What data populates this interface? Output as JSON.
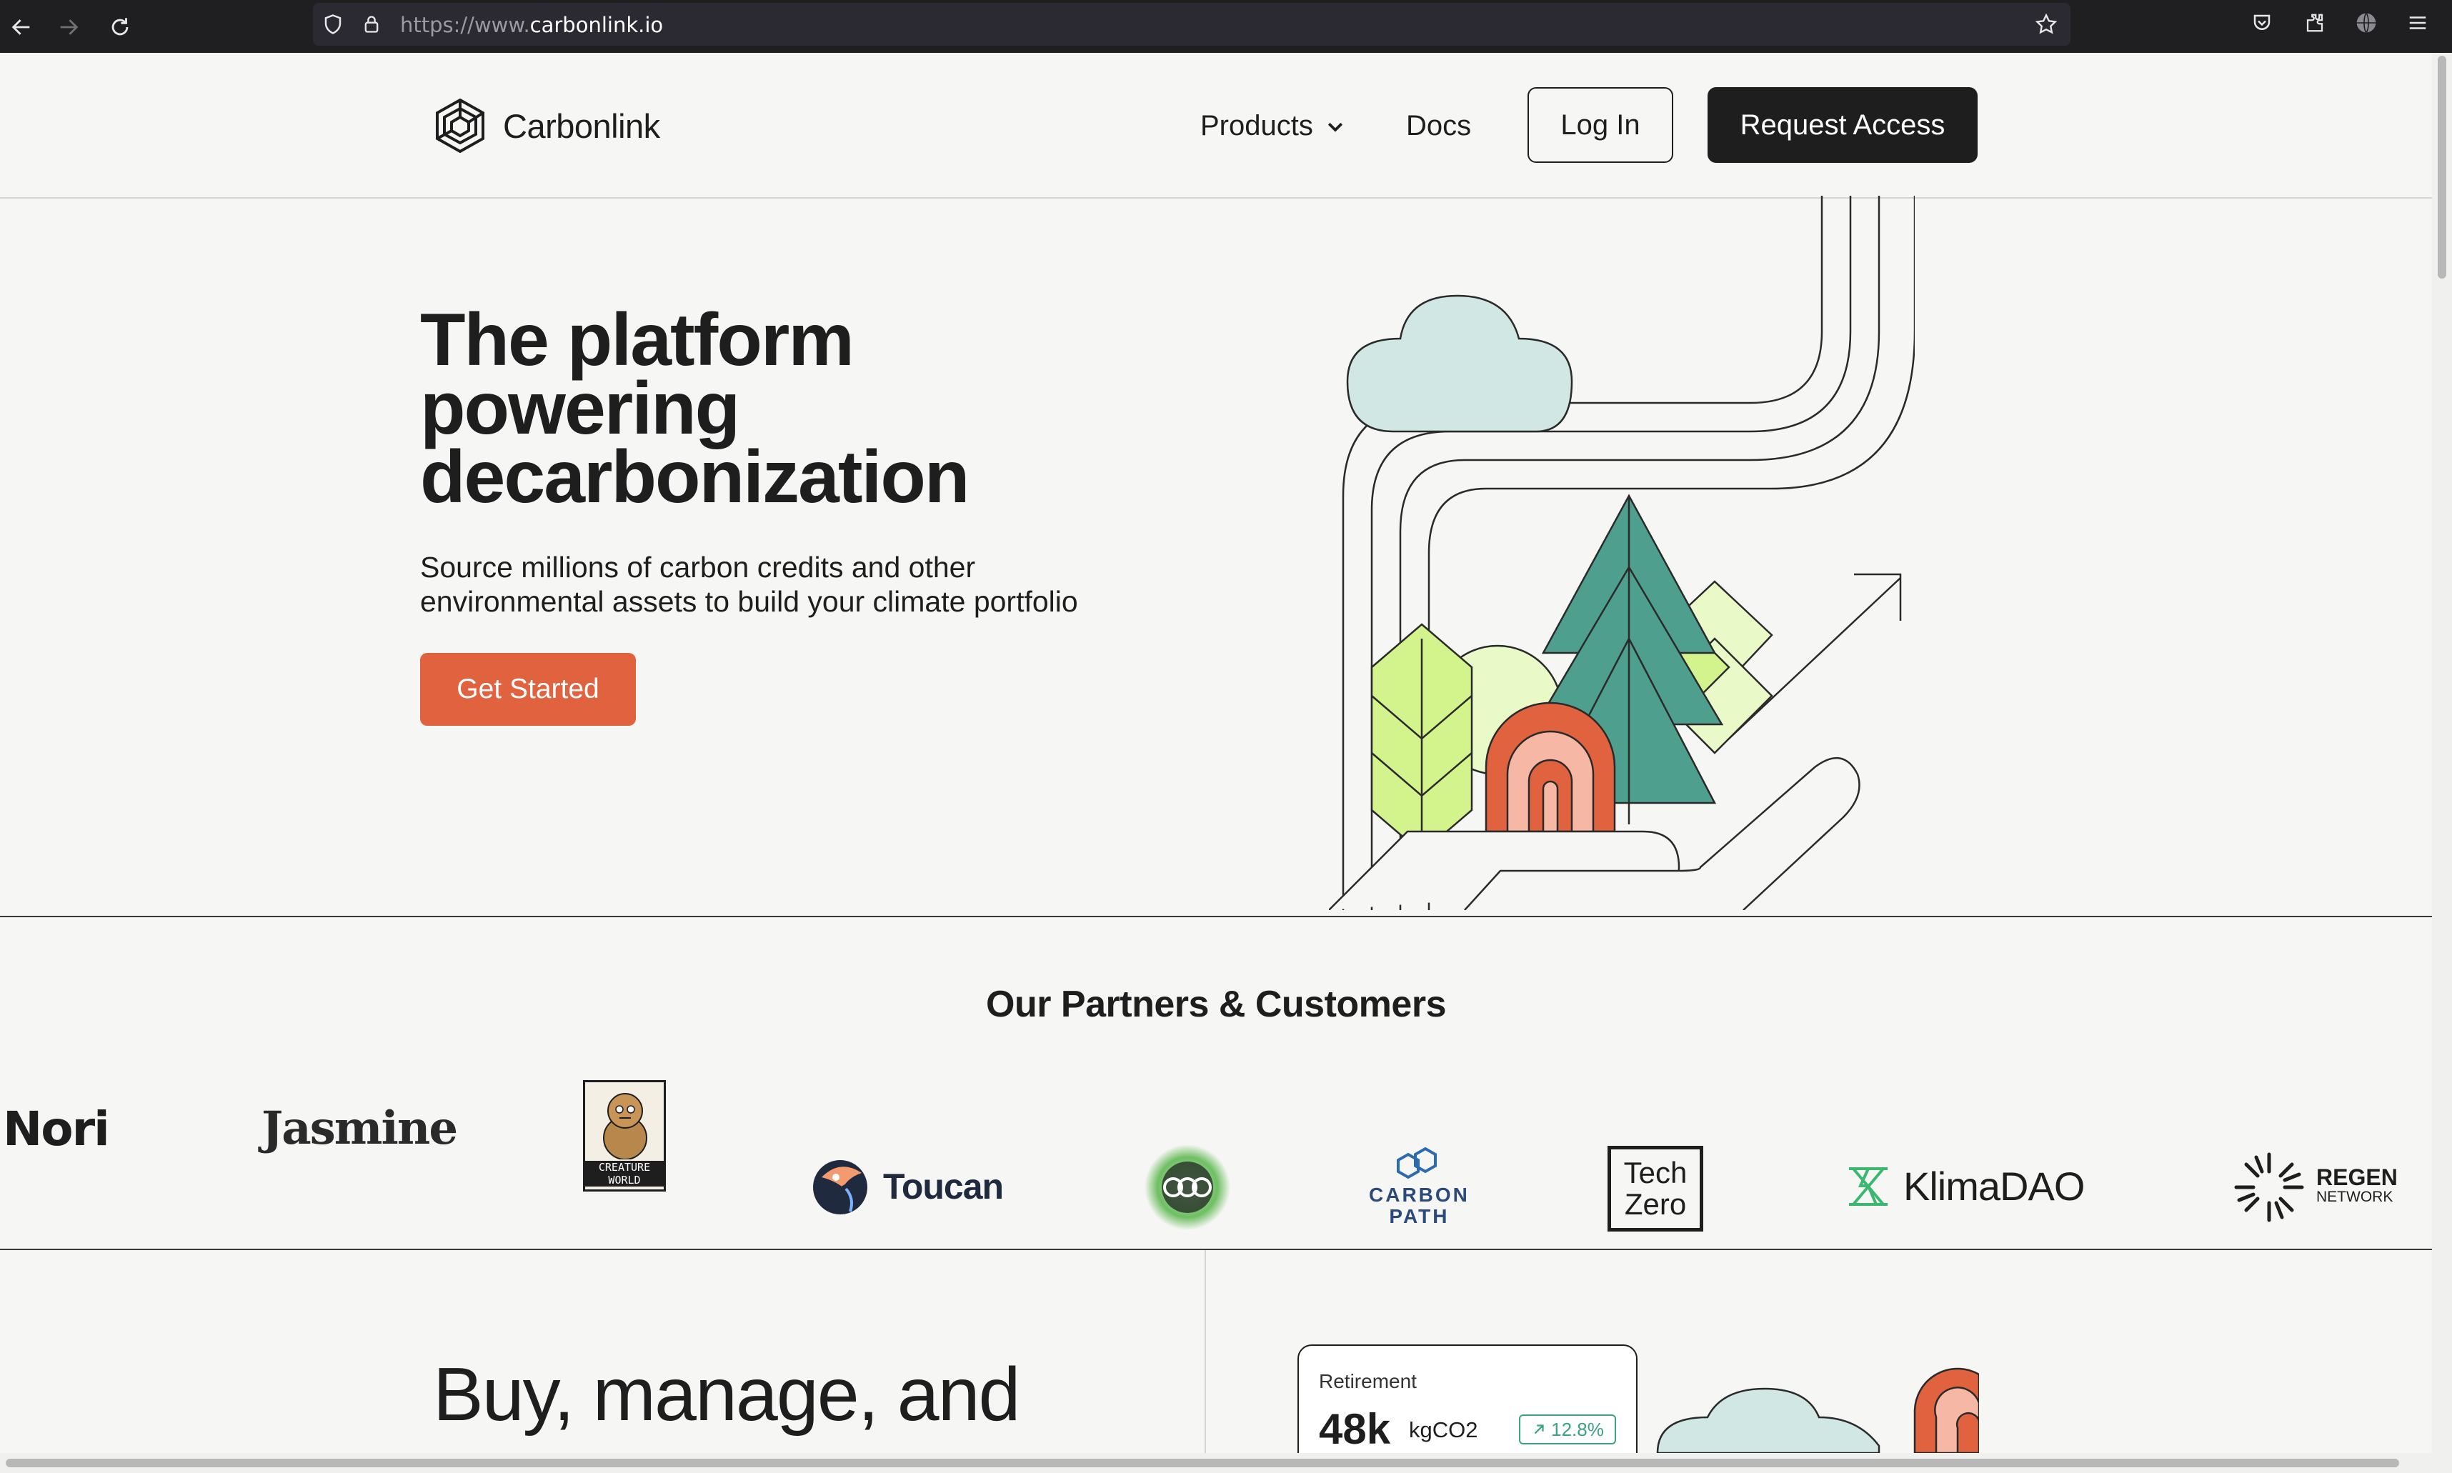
{
  "browser": {
    "url_prefix": "https://www.",
    "url_host": "carbonlink.io",
    "icons": [
      "back-icon",
      "forward-icon",
      "reload-icon",
      "shield-icon",
      "lock-icon",
      "star-icon",
      "pocket-icon",
      "extensions-icon",
      "profile-icon",
      "menu-icon"
    ]
  },
  "header": {
    "brand": "Carbonlink",
    "nav": {
      "products": "Products",
      "docs": "Docs"
    },
    "login": "Log In",
    "request_access": "Request Access"
  },
  "hero": {
    "title_lines": [
      "The platform",
      "powering",
      "decarbonization"
    ],
    "subtitle_lines": [
      "Source millions of carbon credits and other",
      "environmental assets to build your climate portfolio"
    ],
    "cta": "Get Started"
  },
  "partners": {
    "title": "Our Partners & Customers",
    "logos": {
      "nori": "Nori",
      "jasmine": "Jasmine",
      "creature_world": [
        "CREATURE",
        "WORLD"
      ],
      "toucan": "Toucan",
      "carbon_path": [
        "CARBON",
        "PATH"
      ],
      "tech_zero": [
        "Tech",
        "Zero"
      ],
      "klimadao": "KlimaDAO",
      "regen": [
        "REGEN",
        "NETWORK"
      ]
    }
  },
  "section2": {
    "title": "Buy, manage, and",
    "card": {
      "label": "Retirement",
      "value": "48k",
      "unit": "kgCO2",
      "change": "12.8%"
    }
  },
  "colors": {
    "accent": "#e0623f",
    "dark": "#1e1e1e",
    "background": "#f6f6f4",
    "tree": "#4f9f8f",
    "leaf": "#d3f38c",
    "cloud": "#d0e7e4",
    "positive": "#3aa383"
  }
}
